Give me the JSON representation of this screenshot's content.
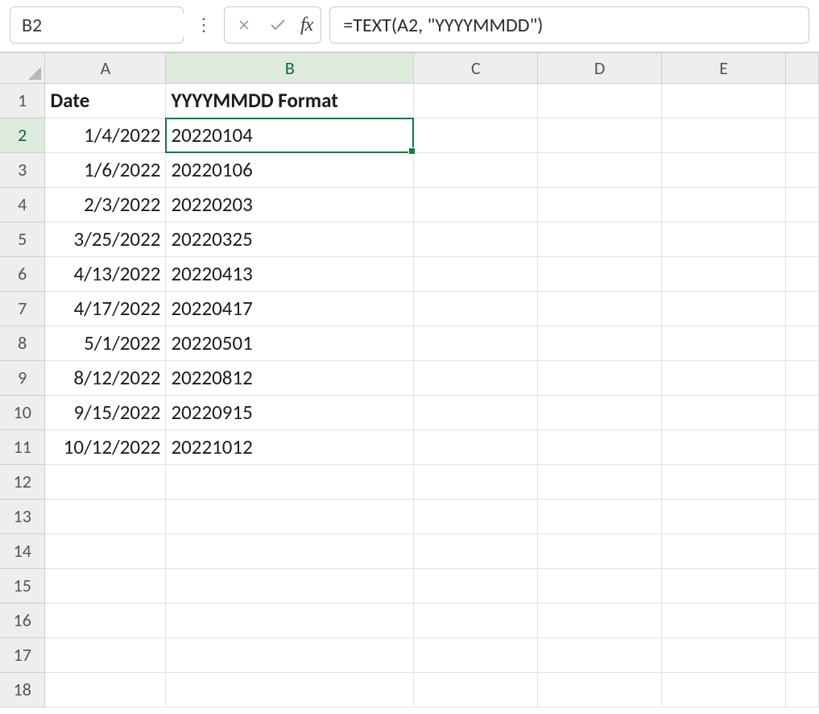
{
  "nameBox": {
    "value": "B2"
  },
  "formulaBar": {
    "value": "=TEXT(A2, \"YYYYMMDD\")"
  },
  "columns": [
    "A",
    "B",
    "C",
    "D",
    "E",
    ""
  ],
  "rows": [
    "1",
    "2",
    "3",
    "4",
    "5",
    "6",
    "7",
    "8",
    "9",
    "10",
    "11",
    "12",
    "13",
    "14",
    "15",
    "16",
    "17",
    "18"
  ],
  "selected": {
    "row": 2,
    "col": "B"
  },
  "headers": {
    "A1": "Date",
    "B1": "YYYYMMDD Format"
  },
  "data": {
    "A": [
      "1/4/2022",
      "1/6/2022",
      "2/3/2022",
      "3/25/2022",
      "4/13/2022",
      "4/17/2022",
      "5/1/2022",
      "8/12/2022",
      "9/15/2022",
      "10/12/2022"
    ],
    "B": [
      "20220104",
      "20220106",
      "20220203",
      "20220325",
      "20220413",
      "20220417",
      "20220501",
      "20220812",
      "20220915",
      "20221012"
    ]
  }
}
